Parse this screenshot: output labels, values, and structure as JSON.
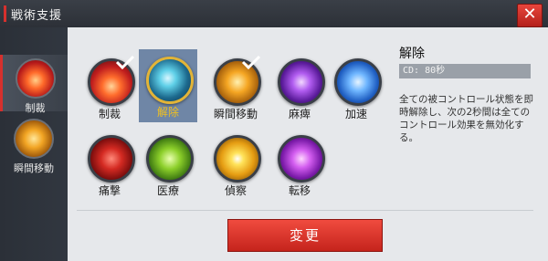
{
  "window": {
    "title": "戦術支援",
    "close_label": "✕"
  },
  "sidebar": {
    "items": [
      {
        "label": "制裁",
        "icon": "sanction-icon",
        "active": true
      },
      {
        "label": "瞬間移動",
        "icon": "teleport-icon",
        "active": false
      }
    ]
  },
  "skills": [
    {
      "label": "制裁",
      "icon": "sanction-icon",
      "checked": true
    },
    {
      "label": "解除",
      "icon": "release-icon",
      "selected": true
    },
    {
      "label": "瞬間移動",
      "icon": "teleport-icon",
      "checked": true
    },
    {
      "label": "麻痺",
      "icon": "paralysis-icon"
    },
    {
      "label": "加速",
      "icon": "accelerate-icon"
    },
    {
      "label": "痛撃",
      "icon": "critical-strike-icon"
    },
    {
      "label": "医療",
      "icon": "heal-icon"
    },
    {
      "label": "偵察",
      "icon": "recon-icon"
    },
    {
      "label": "転移",
      "icon": "transfer-icon"
    }
  ],
  "detail": {
    "title": "解除",
    "cooldown": "CD: 80秒",
    "description": "全ての被コントロール状態を即時解除し、次の2秒間は全てのコントロール効果を無効化する。"
  },
  "actions": {
    "change_label": "変更"
  },
  "colors": {
    "accent": "#d6302d",
    "selected_tile": "#6f86a6",
    "selected_label": "#f0c020"
  }
}
